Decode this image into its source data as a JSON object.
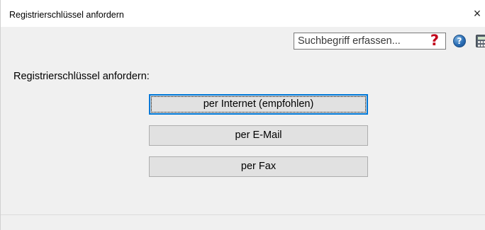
{
  "window": {
    "title": "Registrierschlüssel anfordern",
    "close_glyph": "×"
  },
  "toolbar": {
    "search_placeholder": "Suchbegriff erfassen...",
    "red_help_glyph": "?",
    "help_glyph": "?",
    "icons": [
      "question-mark-icon",
      "help-icon",
      "calculator-icon"
    ],
    "colors": {
      "red_help": "#c0001a",
      "help_blue": "#2a6db5"
    }
  },
  "main": {
    "label": "Registrierschlüssel anfordern:",
    "buttons": [
      {
        "label": "per Internet (empfohlen)",
        "default": true
      },
      {
        "label": "per E-Mail",
        "default": false
      },
      {
        "label": "per Fax",
        "default": false
      }
    ]
  }
}
